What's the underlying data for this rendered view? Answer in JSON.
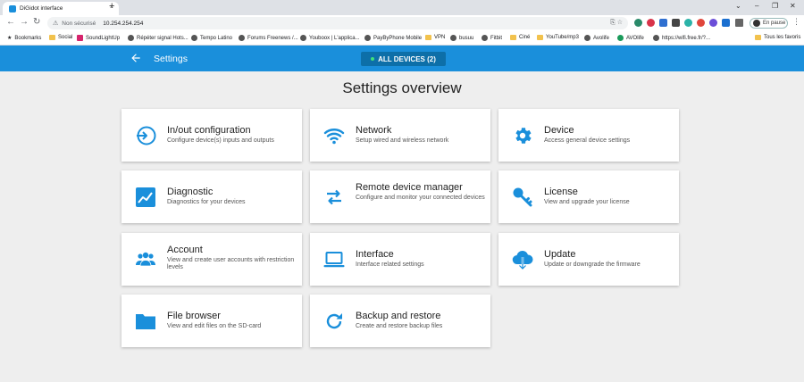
{
  "browser": {
    "tab_title": "DiGidot interface",
    "tab_close": "×",
    "new_tab": "+",
    "window_controls": [
      "⌄",
      "–",
      "❐",
      "✕"
    ],
    "insecure_label": "Non sécurisé",
    "url": "10.254.254.254",
    "profile_label": "En pause"
  },
  "bookmarks": [
    {
      "label": "Bookmarks",
      "icon": "star-icon"
    },
    {
      "label": "Social",
      "icon": "folder-icon"
    },
    {
      "label": "SoundLightUp",
      "icon": "site-icon"
    },
    {
      "label": "Répéter signal Hots...",
      "icon": "globe-icon"
    },
    {
      "label": "Tempo Latino",
      "icon": "globe-icon"
    },
    {
      "label": "Forums Freenews /...",
      "icon": "globe-icon"
    },
    {
      "label": "Youboox | L'applica...",
      "icon": "globe-icon"
    },
    {
      "label": "PayByPhone Mobile",
      "icon": "globe-icon"
    },
    {
      "label": "VPN",
      "icon": "folder-icon"
    },
    {
      "label": "busuu",
      "icon": "globe-icon"
    },
    {
      "label": "Fitbit",
      "icon": "globe-icon"
    },
    {
      "label": "Ciné",
      "icon": "folder-icon"
    },
    {
      "label": "YouTube/mp3",
      "icon": "folder-icon"
    },
    {
      "label": "Avolife",
      "icon": "globe-icon"
    },
    {
      "label": "AVOlife",
      "icon": "site-icon"
    },
    {
      "label": "https://wifi.free.fr/?...",
      "icon": "globe-icon"
    },
    {
      "label": "Tous les favoris",
      "icon": "folder-icon"
    }
  ],
  "header": {
    "title": "Settings",
    "devices_button": "ALL DEVICES (2)",
    "accent_color": "#1a8fdb"
  },
  "main": {
    "title": "Settings overview",
    "cards": [
      {
        "title": "In/out configuration",
        "desc": "Configure device(s) inputs and outputs",
        "icon": "login-icon"
      },
      {
        "title": "Network",
        "desc": "Setup wired and wireless network",
        "icon": "wifi-icon"
      },
      {
        "title": "Device",
        "desc": "Access general device settings",
        "icon": "gear-icon"
      },
      {
        "title": "Diagnostic",
        "desc": "Diagnostics for your devices",
        "icon": "chart-icon"
      },
      {
        "title": "Remote device manager",
        "desc": "Configure and monitor your connected devices",
        "icon": "swap-arrows-icon"
      },
      {
        "title": "License",
        "desc": "View and upgrade your license",
        "icon": "key-icon"
      },
      {
        "title": "Account",
        "desc": "View and create user accounts with restriction levels",
        "icon": "users-icon"
      },
      {
        "title": "Interface",
        "desc": "Interface related settings",
        "icon": "laptop-icon"
      },
      {
        "title": "Update",
        "desc": "Update or downgrade the firmware",
        "icon": "cloud-download-icon"
      },
      {
        "title": "File browser",
        "desc": "View and edit files on the SD-card",
        "icon": "folder-icon"
      },
      {
        "title": "Backup and restore",
        "desc": "Create and restore backup files",
        "icon": "refresh-icon"
      }
    ]
  }
}
